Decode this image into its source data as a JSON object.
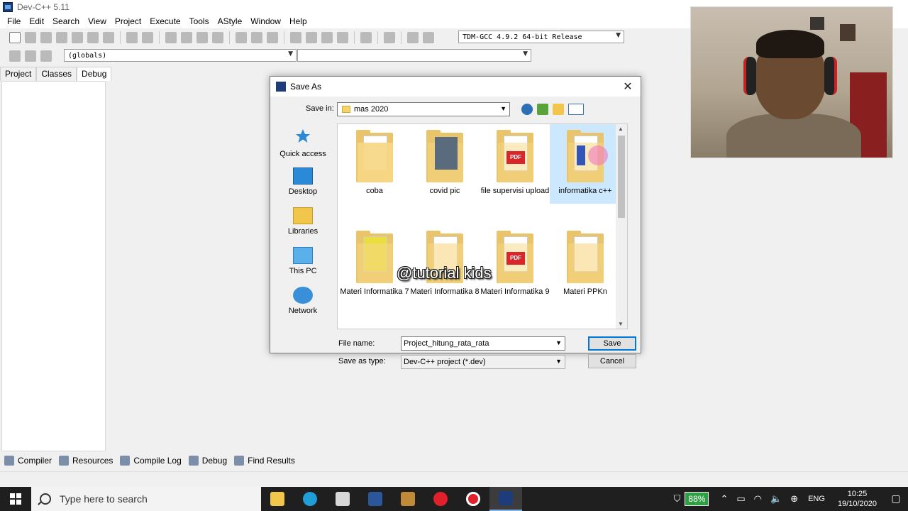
{
  "window": {
    "title": "Dev-C++ 5.11"
  },
  "menu": [
    "File",
    "Edit",
    "Search",
    "View",
    "Project",
    "Execute",
    "Tools",
    "AStyle",
    "Window",
    "Help"
  ],
  "toolbar": {
    "compiler": "TDM-GCC 4.9.2 64-bit Release",
    "scope": "(globals)",
    "function": ""
  },
  "left_tabs": [
    "Project",
    "Classes",
    "Debug"
  ],
  "bottom_tabs": [
    "Compiler",
    "Resources",
    "Compile Log",
    "Debug",
    "Find Results"
  ],
  "dialog": {
    "title": "Save As",
    "save_in_label": "Save in:",
    "save_in_value": "mas 2020",
    "places": [
      "Quick access",
      "Desktop",
      "Libraries",
      "This PC",
      "Network"
    ],
    "files": [
      "coba",
      "covid pic",
      "file supervisi upload",
      "informatika c++",
      "Materi Informatika 7",
      "Materi Informatika 8",
      "Materi Informatika 9",
      "Materi PPKn"
    ],
    "file_name_label": "File name:",
    "file_name_value": "Project_hitung_rata_rata",
    "save_type_label": "Save as type:",
    "save_type_value": "Dev-C++ project (*.dev)",
    "save_button": "Save",
    "cancel_button": "Cancel",
    "pdf_badge": "PDF"
  },
  "watermark": "@tutorial kids",
  "taskbar": {
    "search_placeholder": "Type here to search",
    "battery": "88%",
    "language": "ENG",
    "time": "10:25",
    "date": "19/10/2020"
  }
}
